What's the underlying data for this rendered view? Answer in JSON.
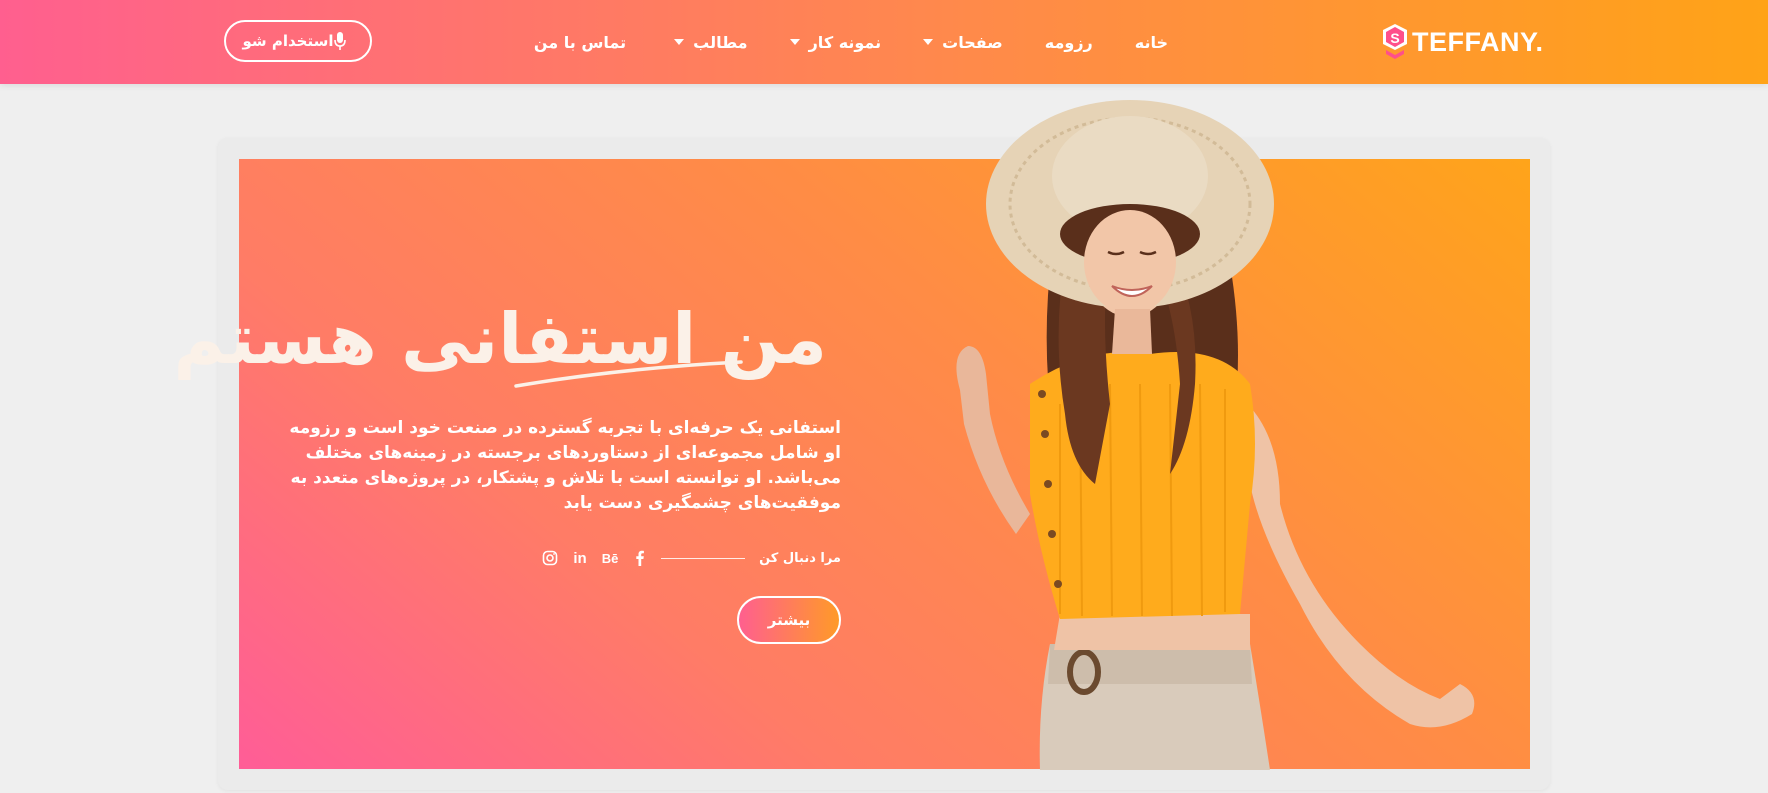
{
  "header": {
    "logo_text": "TEFFANY.",
    "logo_mark_letter": "S",
    "nav": [
      {
        "label": "خانه",
        "dropdown": false
      },
      {
        "label": "رزومه",
        "dropdown": false
      },
      {
        "label": "صفحات",
        "dropdown": true
      },
      {
        "label": "نمونه کار",
        "dropdown": true
      },
      {
        "label": "مطالب",
        "dropdown": true
      },
      {
        "label": "تماس با من",
        "dropdown": false
      }
    ],
    "hire_button": "استخدام شو"
  },
  "hero": {
    "headline_part1": "من ",
    "headline_highlight": "استفانی",
    "headline_part2": " هستم",
    "intro": "استفانی یک حرفه‌ای با تجربه گسترده در صنعت خود است و رزومه او شامل مجموعه‌ای از دستاوردهای برجسته در زمینه‌های مختلف می‌باشد. او توانسته است با تلاش و پشتکار، در پروژه‌های متعدد به موفقیت‌های چشمگیری دست یابد",
    "follow_label": "مرا دنبال کن",
    "social": [
      "facebook-icon",
      "behance-icon",
      "linkedin-icon",
      "instagram-icon"
    ],
    "behance_text": "Bē",
    "linkedin_text": "in",
    "more_button": "بیشتر"
  },
  "colors": {
    "gradient_pink": "#ff5f8f",
    "gradient_orange": "#ffa317",
    "background": "#efefef"
  }
}
